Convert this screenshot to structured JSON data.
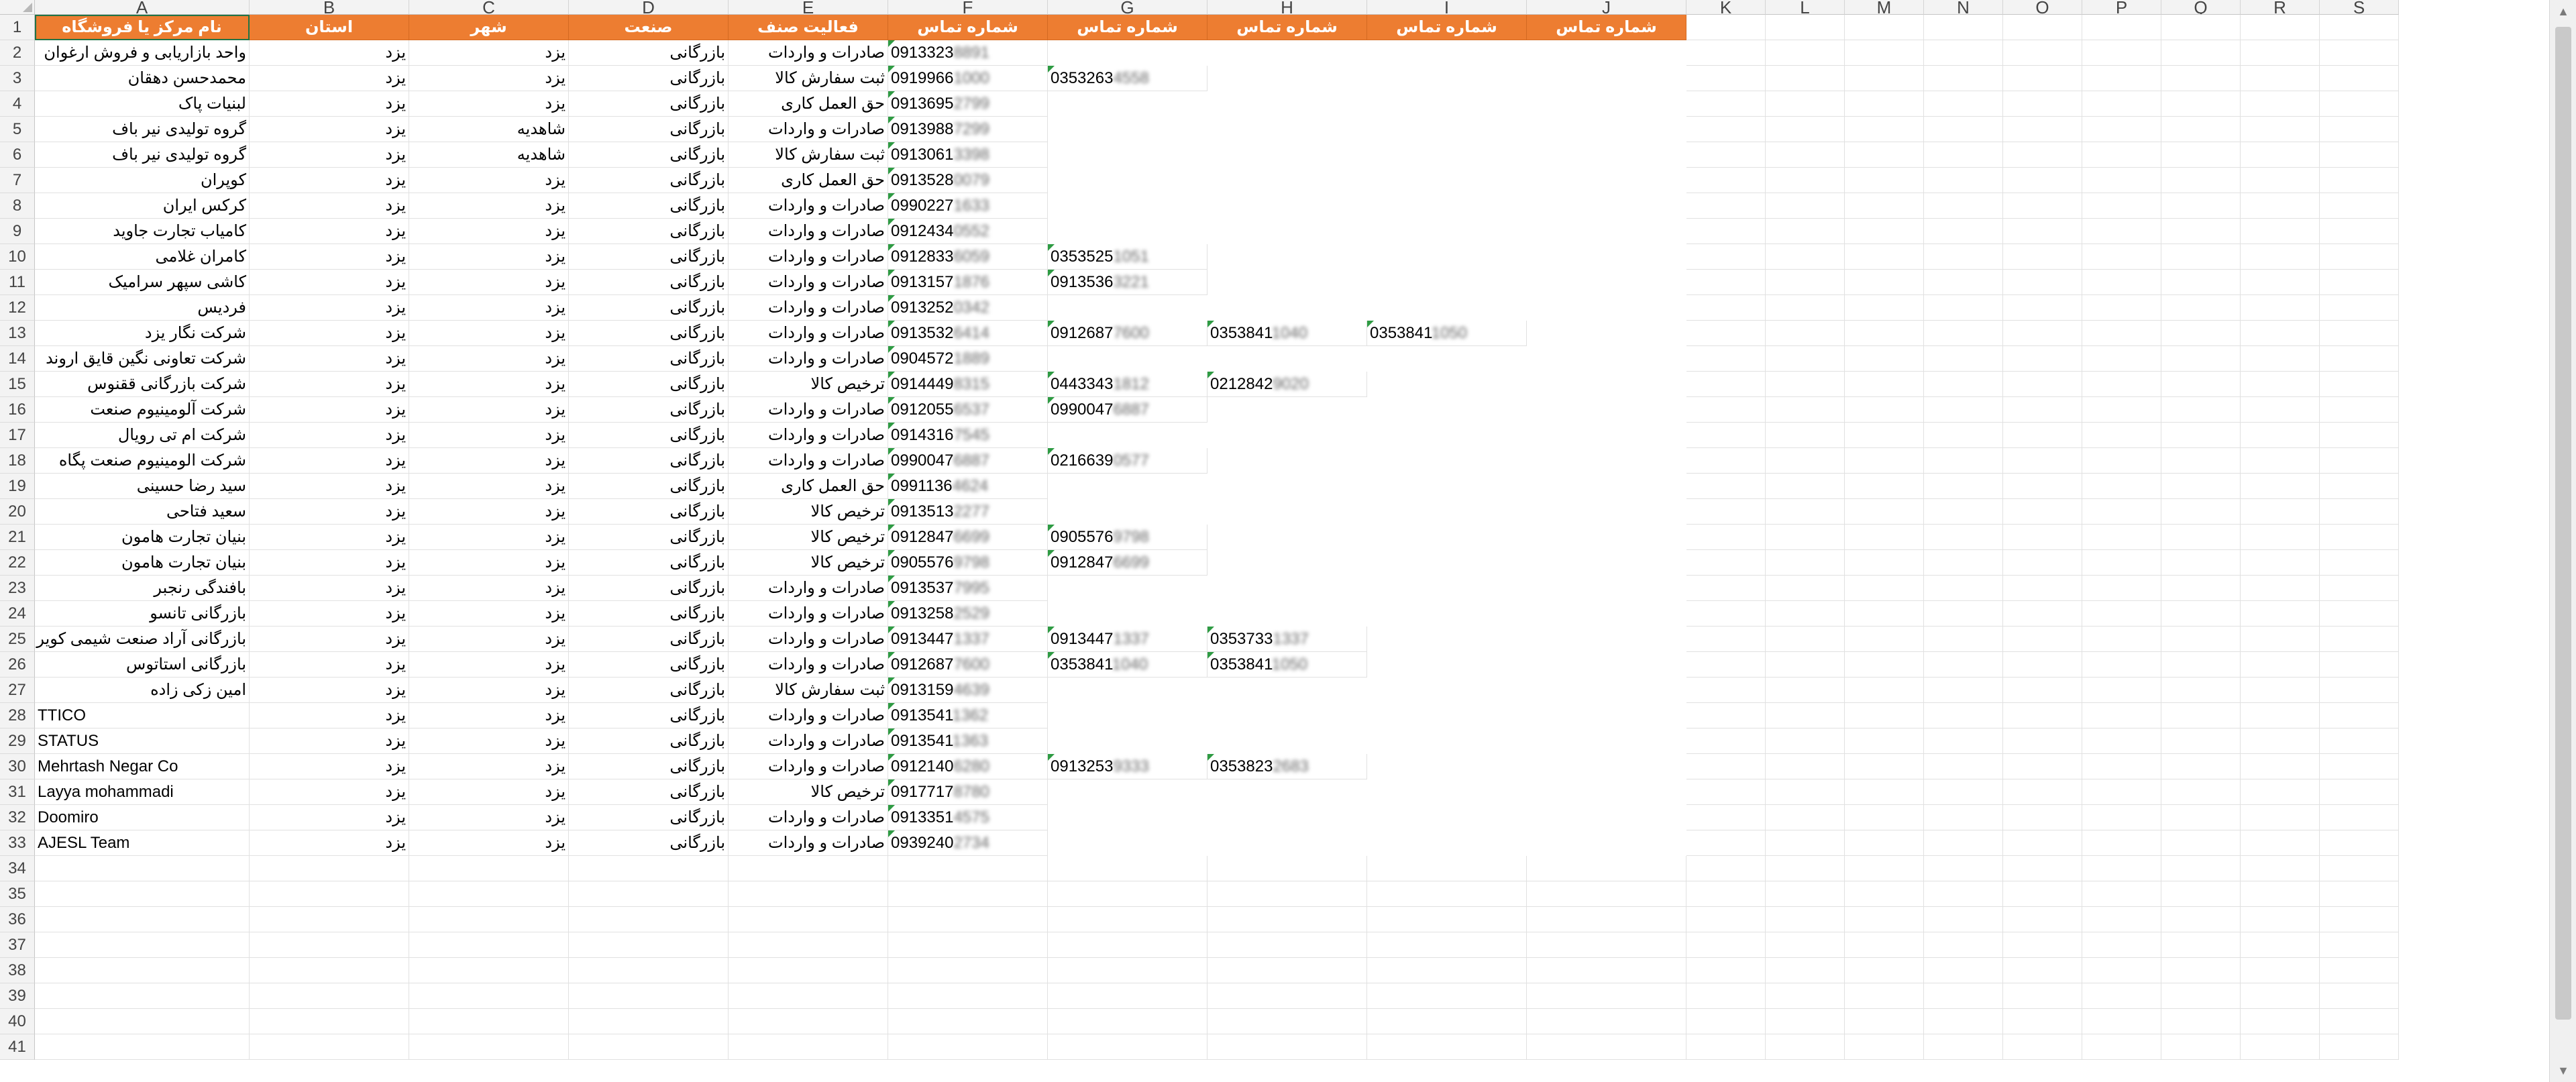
{
  "columns": [
    "A",
    "B",
    "C",
    "D",
    "E",
    "F",
    "G",
    "H",
    "I",
    "J",
    "K",
    "L",
    "M",
    "N",
    "O",
    "P",
    "Q",
    "R",
    "S"
  ],
  "header_row": [
    "نام مرکز یا فروشگاه",
    "استان",
    "شهر",
    "صنعت",
    "فعالیت صنف",
    "شماره تماس",
    "شماره تماس",
    "شماره تماس",
    "شماره تماس",
    "شماره تماس"
  ],
  "rows": [
    [
      "واحد بازاریابی و فروش ارغوان",
      "یزد",
      "یزد",
      "بازرگانی",
      "صادرات و واردات",
      "09133238891",
      "",
      "",
      "",
      ""
    ],
    [
      "محمدحسن دهقان",
      "یزد",
      "یزد",
      "بازرگانی",
      "ثبت سفارش کالا",
      "09199661000",
      "03532634558",
      "",
      "",
      ""
    ],
    [
      "لبنیات پاک",
      "یزد",
      "یزد",
      "بازرگانی",
      "حق العمل کاری",
      "09136952799",
      "",
      "",
      "",
      ""
    ],
    [
      "گروه تولیدی نیر باف",
      "یزد",
      "شاهدیه",
      "بازرگانی",
      "صادرات و واردات",
      "09139887299",
      "",
      "",
      "",
      ""
    ],
    [
      "گروه تولیدی نیر باف",
      "یزد",
      "شاهدیه",
      "بازرگانی",
      "ثبت سفارش کالا",
      "09130613398",
      "",
      "",
      "",
      ""
    ],
    [
      "کوپران",
      "یزد",
      "یزد",
      "بازرگانی",
      "حق العمل کاری",
      "09135280079",
      "",
      "",
      "",
      ""
    ],
    [
      "کرکس ایران",
      "یزد",
      "یزد",
      "بازرگانی",
      "صادرات و واردات",
      "09902271633",
      "",
      "",
      "",
      ""
    ],
    [
      "کامیاب تجارت جاوید",
      "یزد",
      "یزد",
      "بازرگانی",
      "صادرات و واردات",
      "09124340552",
      "",
      "",
      "",
      ""
    ],
    [
      "کامران غلامی",
      "یزد",
      "یزد",
      "بازرگانی",
      "صادرات و واردات",
      "09128336059",
      "03535251051",
      "",
      "",
      ""
    ],
    [
      "کاشی سپهر سرامیک",
      "یزد",
      "یزد",
      "بازرگانی",
      "صادرات و واردات",
      "09131571876",
      "09135363221",
      "",
      "",
      ""
    ],
    [
      "فردیس",
      "یزد",
      "یزد",
      "بازرگانی",
      "صادرات و واردات",
      "09132520342",
      "",
      "",
      "",
      ""
    ],
    [
      "شرکت نگار یزد",
      "یزد",
      "یزد",
      "بازرگانی",
      "صادرات و واردات",
      "09135326414",
      "09126877600",
      "03538411040",
      "03538411050",
      ""
    ],
    [
      "شرکت تعاونی نگین قایق اروند",
      "یزد",
      "یزد",
      "بازرگانی",
      "صادرات و واردات",
      "09045721889",
      "",
      "",
      "",
      ""
    ],
    [
      "شرکت بازرگانی ققنوس",
      "یزد",
      "یزد",
      "بازرگانی",
      "ترخیص کالا",
      "09144498315",
      "04433431812",
      "02128429020",
      "",
      ""
    ],
    [
      "شرکت آلومینیوم صنعت",
      "یزد",
      "یزد",
      "بازرگانی",
      "صادرات و واردات",
      "09120556537",
      "09900476887",
      "",
      "",
      ""
    ],
    [
      "شرکت ام تی رویال",
      "یزد",
      "یزد",
      "بازرگانی",
      "صادرات و واردات",
      "09143167545",
      "",
      "",
      "",
      ""
    ],
    [
      "شرکت الومینیوم صنعت پگاه",
      "یزد",
      "یزد",
      "بازرگانی",
      "صادرات و واردات",
      "09900476887",
      "02166390577",
      "",
      "",
      ""
    ],
    [
      "سید رضا حسینی",
      "یزد",
      "یزد",
      "بازرگانی",
      "حق العمل کاری",
      "09911364624",
      "",
      "",
      "",
      ""
    ],
    [
      "سعید فتاحی",
      "یزد",
      "یزد",
      "بازرگانی",
      "ترخیص کالا",
      "09135132277",
      "",
      "",
      "",
      ""
    ],
    [
      "بنیان تجارت هامون",
      "یزد",
      "یزد",
      "بازرگانی",
      "ترخیص کالا",
      "09128476699",
      "09055769798",
      "",
      "",
      ""
    ],
    [
      "بنیان تجارت هامون",
      "یزد",
      "یزد",
      "بازرگانی",
      "ترخیص کالا",
      "09055769798",
      "09128476699",
      "",
      "",
      ""
    ],
    [
      "بافندگی رنجبر",
      "یزد",
      "یزد",
      "بازرگانی",
      "صادرات و واردات",
      "09135377995",
      "",
      "",
      "",
      ""
    ],
    [
      "بازرگانی تانسو",
      "یزد",
      "یزد",
      "بازرگانی",
      "صادرات و واردات",
      "09132582529",
      "",
      "",
      "",
      ""
    ],
    [
      "بازرگانی آراد صنعت شیمی کویر",
      "یزد",
      "یزد",
      "بازرگانی",
      "صادرات و واردات",
      "09134471337",
      "09134471337",
      "03537331337",
      "",
      ""
    ],
    [
      "بازرگانی استاتوس",
      "یزد",
      "یزد",
      "بازرگانی",
      "صادرات و واردات",
      "09126877600",
      "03538411040",
      "03538411050",
      "",
      ""
    ],
    [
      "امین زکی زاده",
      "یزد",
      "یزد",
      "بازرگانی",
      "ثبت سفارش کالا",
      "09131594639",
      "",
      "",
      "",
      ""
    ],
    [
      "TTICO",
      "یزد",
      "یزد",
      "بازرگانی",
      "صادرات و واردات",
      "09135411362",
      "",
      "",
      "",
      ""
    ],
    [
      "STATUS",
      "یزد",
      "یزد",
      "بازرگانی",
      "صادرات و واردات",
      "09135411363",
      "",
      "",
      "",
      ""
    ],
    [
      "Mehrtash Negar Co",
      "یزد",
      "یزد",
      "بازرگانی",
      "صادرات و واردات",
      "09121406280",
      "09132539333",
      "03538232683",
      "",
      ""
    ],
    [
      "Layya mohammadi",
      "یزد",
      "یزد",
      "بازرگانی",
      "ترخیص کالا",
      "09177178780",
      "",
      "",
      "",
      ""
    ],
    [
      "Doomiro",
      "یزد",
      "یزد",
      "بازرگانی",
      "صادرات و واردات",
      "09133514575",
      "",
      "",
      "",
      ""
    ],
    [
      "AJESL Team",
      "یزد",
      "یزد",
      "بازرگانی",
      "صادرات و واردات",
      "09392402734",
      "",
      "",
      "",
      ""
    ]
  ],
  "visible_row_count": 41,
  "colors": {
    "header_fill": "#ed7d31",
    "header_text": "#ffffff",
    "gridline": "#e1e1e1",
    "number_as_text_flag": "#2e9b43"
  },
  "icons": {
    "corner": "select-all-icon",
    "scroll_up": "scroll-up-icon",
    "scroll_down": "scroll-down-icon"
  }
}
